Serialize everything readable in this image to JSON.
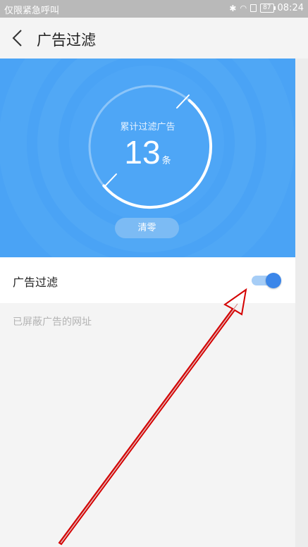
{
  "status_bar": {
    "left_text": "仅限紧急呼叫",
    "battery": "87",
    "time": "08:24"
  },
  "header": {
    "title": "广告过滤",
    "back_icon": "chevron-left-icon"
  },
  "stats": {
    "label": "累计过滤广告",
    "count": "13",
    "unit": "条",
    "clear_label": "清零"
  },
  "filter": {
    "label": "广告过滤",
    "enabled": true
  },
  "blocked_section": {
    "title": "已屏蔽广告的网址"
  },
  "colors": {
    "hero_blue": "#4aa3f5",
    "toggle_on": "#3b86e9",
    "annotation_red": "#d40000"
  }
}
